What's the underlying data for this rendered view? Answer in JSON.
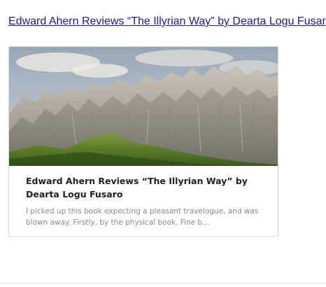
{
  "top_link": {
    "text": "Edward Ahern Reviews “The Illyrian Way” by Dearta Logu Fusaro"
  },
  "card": {
    "title": "Edward Ahern Reviews “The Illyrian Way” by Dearta Logu Fusaro",
    "excerpt": "I picked up this book expecting a pleasant travelogue, and was blown away. Firstly, by the physical book. Fine b…"
  },
  "colors": {
    "link": "#1a1aa6",
    "card_border": "#dcdcdc",
    "title": "#222222",
    "excerpt": "#8a8a8a"
  }
}
